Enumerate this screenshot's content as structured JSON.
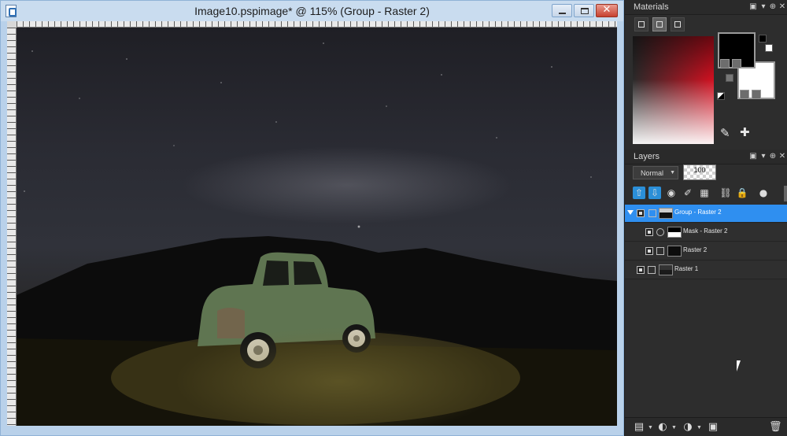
{
  "window": {
    "title": "Image10.pspimage* @ 115% (Group - Raster 2)",
    "close_glyph": "✕"
  },
  "canvas": {
    "description_icon": "photo-canvas"
  },
  "materials": {
    "title": "Materials",
    "fg_color": "#000000",
    "bg_color": "#ffffff",
    "accent": "#d01020"
  },
  "layers": {
    "title": "Layers",
    "blend_mode": "Normal",
    "opacity": "100",
    "items": [
      {
        "name": "Group - Raster 2",
        "selected": true,
        "indent": 0,
        "type": "group"
      },
      {
        "name": "Mask - Raster 2",
        "selected": false,
        "indent": 1,
        "type": "mask"
      },
      {
        "name": "Raster 2",
        "selected": false,
        "indent": 1,
        "type": "raster"
      },
      {
        "name": "Raster 1",
        "selected": false,
        "indent": 0,
        "type": "raster"
      }
    ]
  },
  "colors": {
    "selection": "#2f8ff0",
    "panel_bg": "#2d2d2d",
    "title_bar": "#c9dcef"
  }
}
